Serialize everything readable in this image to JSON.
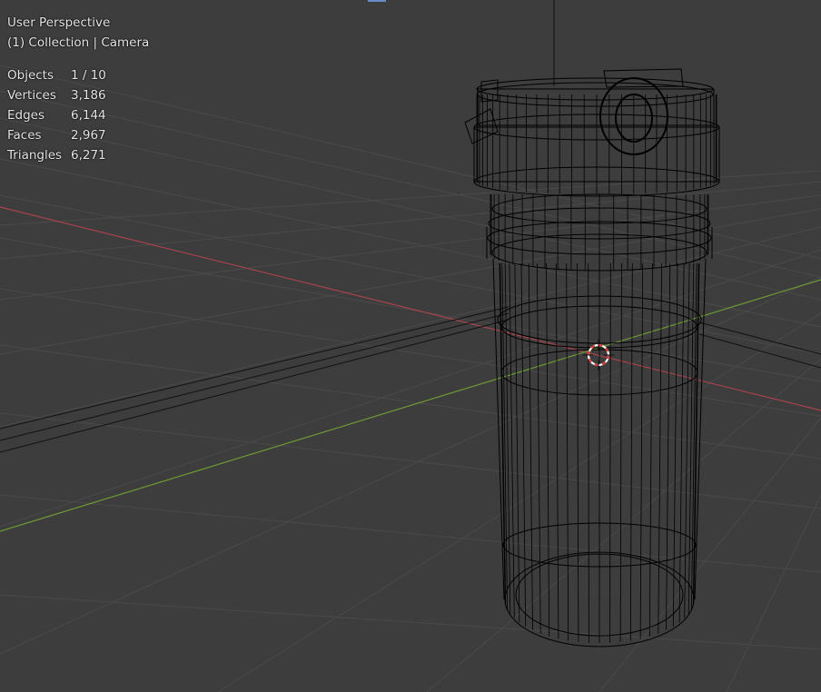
{
  "viewport": {
    "view_name": "User Perspective",
    "collection_line": "(1) Collection | Camera"
  },
  "stats": [
    {
      "label": "Objects",
      "value": "1 / 10"
    },
    {
      "label": "Vertices",
      "value": "3,186"
    },
    {
      "label": "Edges",
      "value": "6,144"
    },
    {
      "label": "Faces",
      "value": "2,967"
    },
    {
      "label": "Triangles",
      "value": "6,271"
    }
  ],
  "colors": {
    "background": "#3d3d3d",
    "grid": "#4a4a4a",
    "x_axis": "#a8434d",
    "y_axis": "#6d9a35",
    "wireframe": "#000000",
    "cursor_red": "#d83a3a",
    "cursor_white": "#ffffff"
  },
  "icons": {
    "cursor": "3d-cursor-icon"
  }
}
